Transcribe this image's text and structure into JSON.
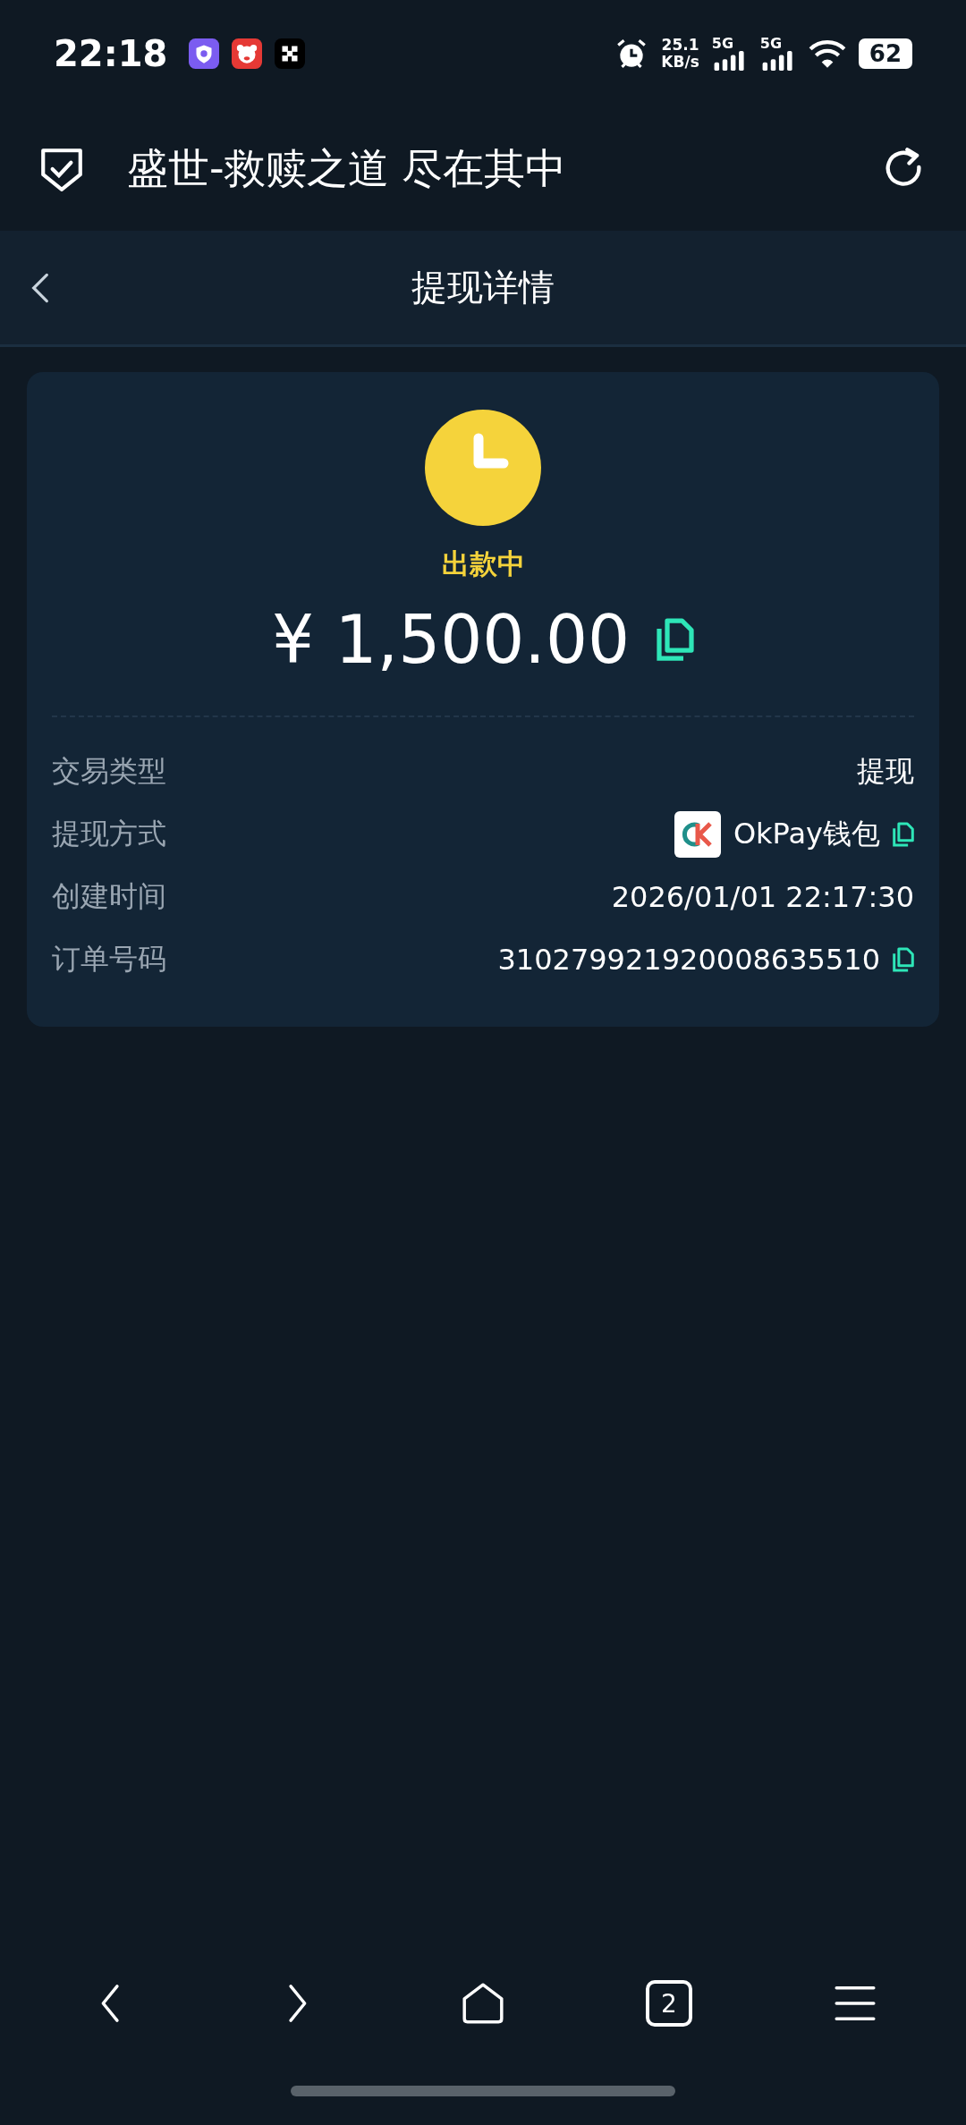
{
  "status_bar": {
    "time": "22:18",
    "net_speed": "25.1",
    "net_unit": "KB/s",
    "signals": [
      "5G",
      "5G"
    ],
    "battery": "62"
  },
  "app_bar": {
    "title": "盛世-救赎之道 尽在其中"
  },
  "page": {
    "title": "提现详情"
  },
  "summary": {
    "status": "出款中",
    "amount": "¥ 1,500.00"
  },
  "details": [
    {
      "kind": "plain",
      "label": "交易类型",
      "value": "提现"
    },
    {
      "kind": "wallet",
      "label": "提现方式",
      "value": "OkPay钱包"
    },
    {
      "kind": "plain",
      "label": "创建时间",
      "value": "2026/01/01 22:17:30"
    },
    {
      "kind": "copy",
      "label": "订单号码",
      "value": "310279921920008635510"
    }
  ],
  "nav": {
    "tab_count": "2"
  }
}
